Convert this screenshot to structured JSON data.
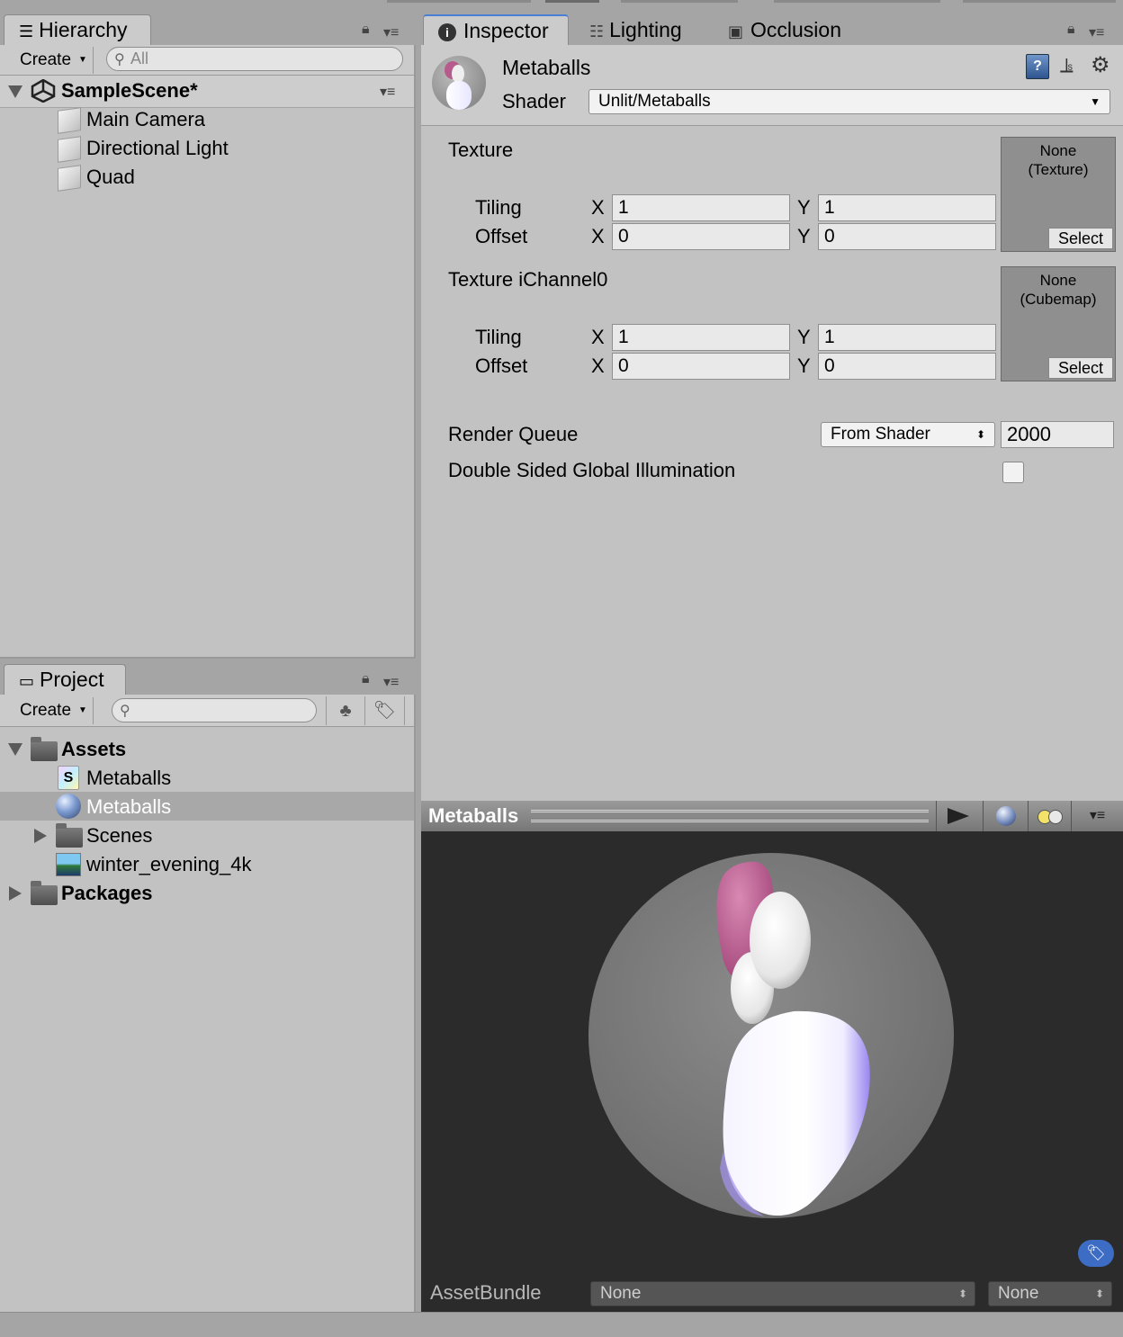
{
  "hierarchy": {
    "tab_label": "Hierarchy",
    "create_label": "Create",
    "search_placeholder": "All",
    "scene_name": "SampleScene*",
    "objects": [
      "Main Camera",
      "Directional Light",
      "Quad"
    ]
  },
  "project": {
    "tab_label": "Project",
    "create_label": "Create",
    "assets_label": "Assets",
    "asset_items": [
      {
        "label": "Metaballs",
        "icon": "shader-icon"
      },
      {
        "label": "Metaballs",
        "icon": "material-icon",
        "selected": true
      },
      {
        "label": "Scenes",
        "icon": "folder-icon"
      },
      {
        "label": "winter_evening_4k",
        "icon": "texture-icon"
      }
    ],
    "packages_label": "Packages"
  },
  "tabs": {
    "inspector": "Inspector",
    "lighting": "Lighting",
    "occlusion": "Occlusion"
  },
  "material": {
    "name": "Metaballs",
    "shader_label": "Shader",
    "shader_value": "Unlit/Metaballs"
  },
  "properties": {
    "texture": {
      "label": "Texture",
      "slot_line1": "None",
      "slot_line2": "(Texture)",
      "select_label": "Select",
      "tiling_label": "Tiling",
      "offset_label": "Offset",
      "x_label": "X",
      "y_label": "Y",
      "tiling_x": "1",
      "tiling_y": "1",
      "offset_x": "0",
      "offset_y": "0"
    },
    "ichannel0": {
      "label": "Texture iChannel0",
      "slot_line1": "None",
      "slot_line2": "(Cubemap)",
      "select_label": "Select",
      "tiling_label": "Tiling",
      "offset_label": "Offset",
      "x_label": "X",
      "y_label": "Y",
      "tiling_x": "1",
      "tiling_y": "1",
      "offset_x": "0",
      "offset_y": "0"
    },
    "render_queue_label": "Render Queue",
    "render_queue_mode": "From Shader",
    "render_queue_value": "2000",
    "double_sided_label": "Double Sided Global Illumination",
    "double_sided_checked": false
  },
  "preview": {
    "title": "Metaballs",
    "assetbundle_label": "AssetBundle",
    "assetbundle_value": "None",
    "variant_value": "None"
  },
  "colors": {
    "panel": "#c2c2c2",
    "selection": "#a8a8a8",
    "preview_bg": "#2b2b2b",
    "accent_blue": "#3d6cc4"
  }
}
